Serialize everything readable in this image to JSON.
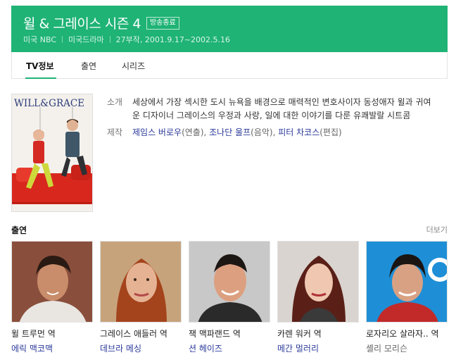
{
  "header": {
    "title": "윌 & 그레이스 시즌 4",
    "badge": "방송종료",
    "country": "미국 NBC",
    "genre": "미국드라마",
    "episodes_dates": "27부작, 2001.9.17~2002.5.16"
  },
  "tabs": [
    {
      "label": "TV정보"
    },
    {
      "label": "출연"
    },
    {
      "label": "시리즈"
    }
  ],
  "poster": {
    "logo_text": "WILL&GRACE"
  },
  "info": {
    "synopsis_label": "소개",
    "synopsis": "세상에서 가장 섹시한 도시 뉴욕을 배경으로 매력적인 변호사이자 동성애자 윌과 귀여운 디자이너 그레이스의 우정과 사랑, 일에 대한 이야기를 다룬 유쾌발랄 시트콤",
    "producer_label": "제작",
    "producers": [
      {
        "name": "제임스 버로우",
        "role": "(연출), "
      },
      {
        "name": "조나단 울프",
        "role": "(음악), "
      },
      {
        "name": "피터 차코스",
        "role": "(편집)"
      }
    ]
  },
  "cast_section": {
    "title": "출연",
    "more": "더보기"
  },
  "cast": [
    {
      "role": "윌 트루먼 역",
      "name": "에릭 맥코맥"
    },
    {
      "role": "그레이스 애들러 역",
      "name": "데브라 메싱"
    },
    {
      "role": "잭 맥파랜드 역",
      "name": "션 헤이즈"
    },
    {
      "role": "카렌 워커 역",
      "name": "메간 멀러리"
    },
    {
      "role": "로자리오 살라자.. 역",
      "name": "셸리 모리슨"
    }
  ],
  "colors": {
    "accent": "#1fb376",
    "link": "#2b3a9a"
  }
}
